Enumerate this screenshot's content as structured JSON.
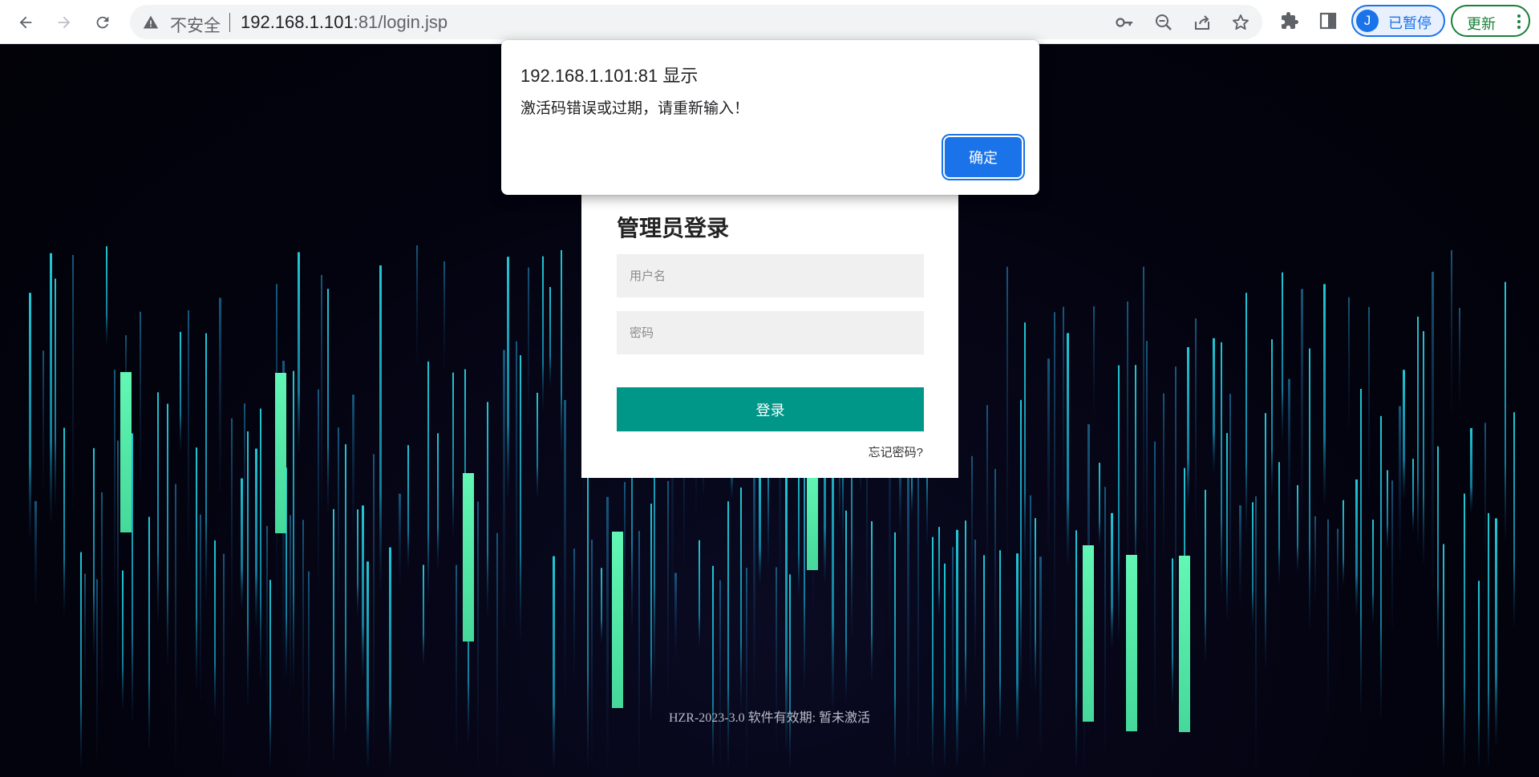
{
  "browser": {
    "security_label": "不安全",
    "url_host": "192.168.1.101",
    "url_rest": ":81/login.jsp",
    "profile_initial": "J",
    "profile_status": "已暂停",
    "update_label": "更新",
    "icons": [
      "back-icon",
      "forward-icon",
      "reload-icon",
      "warning-icon",
      "key-icon",
      "zoom-out-icon",
      "share-icon",
      "star-icon",
      "extensions-icon",
      "side-panel-icon",
      "more-vert-icon"
    ]
  },
  "dialog": {
    "title": "192.168.1.101:81 显示",
    "message": "激活码错误或过期，请重新输入！",
    "ok_label": "确定"
  },
  "login": {
    "title": "管理员登录",
    "username_placeholder": "用户名",
    "password_placeholder": "密码",
    "submit_label": "登录",
    "forgot_label": "忘记密码?"
  },
  "footer": {
    "text": "HZR-2023-3.0 软件有效期: 暂未激活"
  },
  "colors": {
    "primary_button": "#009688",
    "dialog_button": "#1a73e8",
    "bar_bright": "#5cf5b0",
    "bar_cyan": "#1ec8d8"
  }
}
